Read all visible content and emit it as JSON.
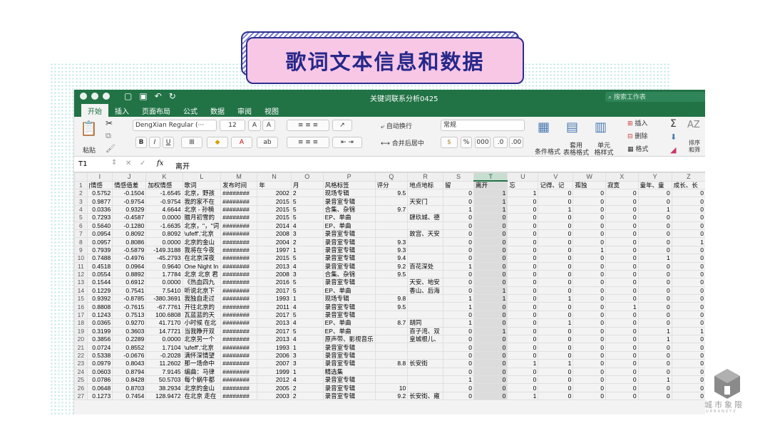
{
  "slide": {
    "title": "歌词文本信息和数据",
    "watermark": "城市象限",
    "watermark_sub": "URBANXYZ"
  },
  "window": {
    "doc_title": "关键词联系分析0425",
    "search_placeholder": "搜索工作表"
  },
  "tabs": [
    "开始",
    "插入",
    "页面布局",
    "公式",
    "数据",
    "审阅",
    "视图"
  ],
  "ribbon": {
    "paste": "粘贴",
    "font_name": "DengXian Regular (···",
    "font_size": "12",
    "bold": "B",
    "italic": "I",
    "underline": "U",
    "wrap": "自动换行",
    "merge": "合并后居中",
    "number_format": "常规",
    "percent": "%",
    "thousands": "000",
    "cond_format": "条件格式",
    "table_format": "套用\n表格格式",
    "cell_style": "单元\n格样式",
    "insert": "插入",
    "delete": "删除",
    "format": "格式",
    "sort": "排序\n和筛"
  },
  "formula": {
    "cell_ref": "T1",
    "fx": "fx",
    "value": "离开"
  },
  "columns": [
    "I",
    "J",
    "K",
    "L",
    "M",
    "N",
    "O",
    "P",
    "Q",
    "R",
    "S",
    "T",
    "U",
    "V",
    "W",
    "X",
    "Y",
    "Z"
  ],
  "headers": [
    "|情感",
    "情感值差",
    "加权情感",
    "歌词",
    "发布时间",
    "年",
    "月",
    "风格标签",
    "评分",
    "地点地标",
    "留",
    "离开",
    "忘",
    "记得、记",
    "孤独",
    "寂寞",
    "童年、童",
    "成长、长"
  ],
  "rows": [
    [
      "0.5752",
      "-0.1504",
      "-1.6545",
      "北京，野孩",
      "########",
      "2002",
      "2",
      "现场专辑",
      "9.5",
      "",
      "0",
      "1",
      "1",
      "0",
      "0",
      "0",
      "0",
      "0"
    ],
    [
      "0.9877",
      "-0.9754",
      "-0.9754",
      "我的家不在",
      "########",
      "2015",
      "5",
      "录音室专辑",
      "",
      "天安门",
      "0",
      "1",
      "0",
      "0",
      "0",
      "0",
      "0",
      "0"
    ],
    [
      "0.0336",
      "0.9329",
      "4.6644",
      "北京 - 孙楠",
      "########",
      "2015",
      "5",
      "合集、杂锦",
      "9.7",
      "",
      "1",
      "1",
      "0",
      "1",
      "0",
      "0",
      "1",
      "0"
    ],
    [
      "0.7293",
      "-0.4587",
      "0.0000",
      "腊月初雪的",
      "########",
      "2015",
      "5",
      "EP、单曲",
      "",
      "肆玖城、德",
      "0",
      "0",
      "0",
      "0",
      "0",
      "0",
      "0",
      "0"
    ],
    [
      "0.5640",
      "-0.1280",
      "-1.6635",
      "北京，\"，\"词",
      "########",
      "2014",
      "4",
      "EP、单曲",
      "",
      "",
      "0",
      "0",
      "0",
      "0",
      "0",
      "0",
      "0",
      "0"
    ],
    [
      "0.0954",
      "0.8092",
      "0.8092",
      "\\ufeff','北京",
      "########",
      "2008",
      "3",
      "录音室专辑",
      "",
      "故宫、天安",
      "0",
      "0",
      "0",
      "0",
      "0",
      "0",
      "0",
      "0"
    ],
    [
      "0.0957",
      "0.8086",
      "0.0000",
      "北京的金山",
      "########",
      "2004",
      "2",
      "录音室专辑",
      "9.3",
      "",
      "0",
      "0",
      "0",
      "0",
      "0",
      "0",
      "0",
      "1"
    ],
    [
      "0.7939",
      "-0.5879",
      "-149.3188",
      "我将在今夜",
      "########",
      "1997",
      "1",
      "录音室专辑",
      "9.3",
      "",
      "0",
      "0",
      "0",
      "0",
      "1",
      "0",
      "0",
      "0"
    ],
    [
      "0.7488",
      "-0.4976",
      "-45.2793",
      "在北京深夜",
      "########",
      "2015",
      "5",
      "录音室专辑",
      "9.4",
      "",
      "0",
      "0",
      "0",
      "0",
      "0",
      "0",
      "1",
      "0"
    ],
    [
      "0.4518",
      "0.0964",
      "0.9640",
      "One Night In",
      "########",
      "2013",
      "4",
      "录音室专辑",
      "9.2",
      "百花深处",
      "1",
      "0",
      "0",
      "0",
      "0",
      "0",
      "0",
      "0"
    ],
    [
      "0.0554",
      "0.8892",
      "1.7784",
      "北京 北京 君",
      "########",
      "2008",
      "3",
      "合集、杂锦",
      "9.5",
      "",
      "0",
      "0",
      "0",
      "0",
      "0",
      "0",
      "0",
      "0"
    ],
    [
      "0.1544",
      "0.6912",
      "0.0000",
      "《热血四九",
      "########",
      "2016",
      "5",
      "录音室专辑",
      "",
      "天安、地安",
      "0",
      "0",
      "0",
      "0",
      "0",
      "0",
      "0",
      "0"
    ],
    [
      "0.1229",
      "0.7541",
      "7.5410",
      "听说北京下",
      "########",
      "2017",
      "5",
      "EP、单曲",
      "",
      "香山、后海",
      "0",
      "1",
      "0",
      "0",
      "0",
      "0",
      "0",
      "0"
    ],
    [
      "0.9392",
      "-0.8785",
      "-380.3691",
      "我独自走过",
      "########",
      "1993",
      "1",
      "现场专辑",
      "9.8",
      "",
      "1",
      "1",
      "0",
      "1",
      "0",
      "0",
      "0",
      "0"
    ],
    [
      "0.8808",
      "-0.7615",
      "-67.7761",
      "开往北京的",
      "########",
      "2011",
      "4",
      "录音室专辑",
      "9.5",
      "",
      "1",
      "0",
      "0",
      "0",
      "0",
      "1",
      "0",
      "0"
    ],
    [
      "0.1243",
      "0.7513",
      "100.6808",
      "瓦蓝蓝的天",
      "########",
      "2017",
      "5",
      "录音室专辑",
      "",
      "",
      "0",
      "0",
      "0",
      "0",
      "0",
      "0",
      "0",
      "0"
    ],
    [
      "0.0365",
      "0.9270",
      "41.7170",
      "小时候 在北",
      "########",
      "2013",
      "4",
      "EP、单曲",
      "8.7",
      "胡同",
      "1",
      "0",
      "0",
      "1",
      "0",
      "0",
      "0",
      "0"
    ],
    [
      "0.3199",
      "0.3603",
      "14.7721",
      "当我睁开双",
      "########",
      "2017",
      "5",
      "EP、单曲",
      "",
      "百子湾、双",
      "0",
      "1",
      "0",
      "0",
      "0",
      "0",
      "1",
      "1"
    ],
    [
      "0.3856",
      "0.2289",
      "0.0000",
      "北京另一个",
      "########",
      "2013",
      "4",
      "原声带、影视音乐",
      "",
      "皇城根儿、",
      "0",
      "0",
      "0",
      "0",
      "0",
      "0",
      "1",
      "0"
    ],
    [
      "0.0724",
      "0.8552",
      "1.7104",
      "\\ufeff','北京",
      "########",
      "1993",
      "1",
      "录音室专辑",
      "",
      "",
      "0",
      "0",
      "0",
      "0",
      "0",
      "0",
      "0",
      "0"
    ],
    [
      "0.5338",
      "-0.0676",
      "-0.2028",
      "满怀深情望",
      "########",
      "2006",
      "3",
      "录音室专辑",
      "",
      "",
      "0",
      "0",
      "0",
      "0",
      "0",
      "0",
      "0",
      "0"
    ],
    [
      "0.0979",
      "0.8043",
      "11.2602",
      "那一场命中",
      "########",
      "2007",
      "3",
      "录音室专辑",
      "8.8",
      "长安街",
      "0",
      "0",
      "1",
      "1",
      "0",
      "0",
      "0",
      "0"
    ],
    [
      "0.0603",
      "0.8794",
      "7.9145",
      "编曲：马律",
      "########",
      "1999",
      "1",
      "精选集",
      "",
      "",
      "0",
      "0",
      "0",
      "0",
      "0",
      "0",
      "0",
      "0"
    ],
    [
      "0.0786",
      "0.8428",
      "50.5703",
      "每个蜗牛都",
      "########",
      "2012",
      "4",
      "录音室专辑",
      "",
      "",
      "1",
      "0",
      "0",
      "0",
      "0",
      "0",
      "1",
      "0"
    ],
    [
      "0.0648",
      "0.8703",
      "38.2934",
      "北京的金山",
      "########",
      "2005",
      "2",
      "录音室专辑",
      "10",
      "",
      "0",
      "0",
      "0",
      "0",
      "0",
      "0",
      "0",
      "0"
    ],
    [
      "0.1273",
      "0.7454",
      "128.9472",
      "在北京 走在",
      "########",
      "2003",
      "2",
      "录音室专辑",
      "9.2",
      "长安街、雍",
      "0",
      "0",
      "1",
      "0",
      "0",
      "0",
      "0",
      "0"
    ]
  ]
}
